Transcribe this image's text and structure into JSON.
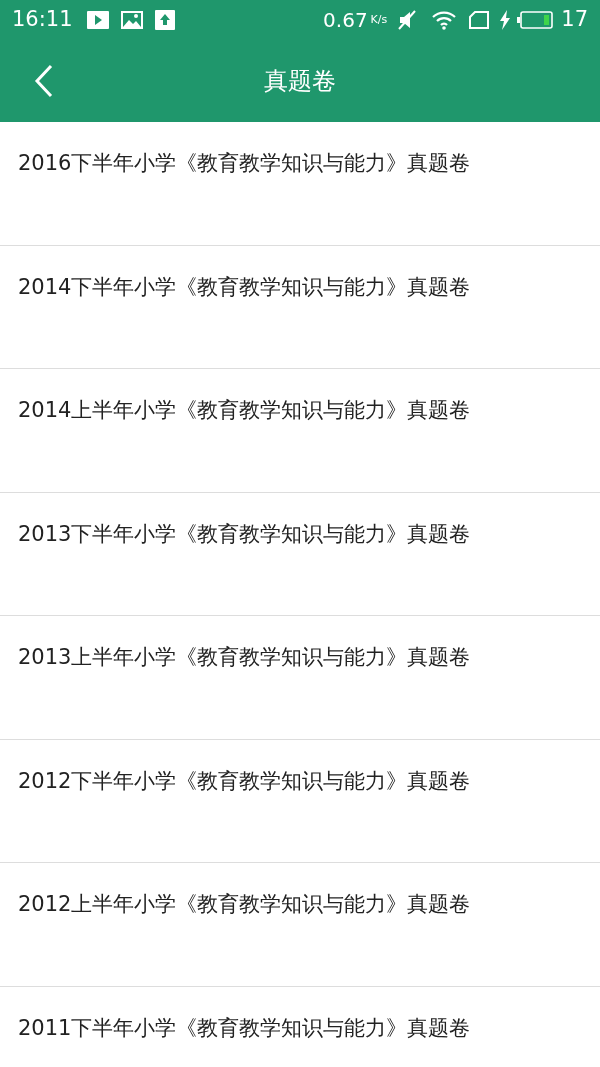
{
  "status_bar": {
    "time": "16:11",
    "speed": "0.67",
    "speed_unit": "K/s",
    "battery": "17"
  },
  "header": {
    "title": "真题卷"
  },
  "papers": [
    {
      "title": "2016下半年小学《教育教学知识与能力》真题卷"
    },
    {
      "title": "2014下半年小学《教育教学知识与能力》真题卷"
    },
    {
      "title": "2014上半年小学《教育教学知识与能力》真题卷"
    },
    {
      "title": "2013下半年小学《教育教学知识与能力》真题卷"
    },
    {
      "title": "2013上半年小学《教育教学知识与能力》真题卷"
    },
    {
      "title": "2012下半年小学《教育教学知识与能力》真题卷"
    },
    {
      "title": "2012上半年小学《教育教学知识与能力》真题卷"
    },
    {
      "title": "2011下半年小学《教育教学知识与能力》真题卷"
    }
  ]
}
